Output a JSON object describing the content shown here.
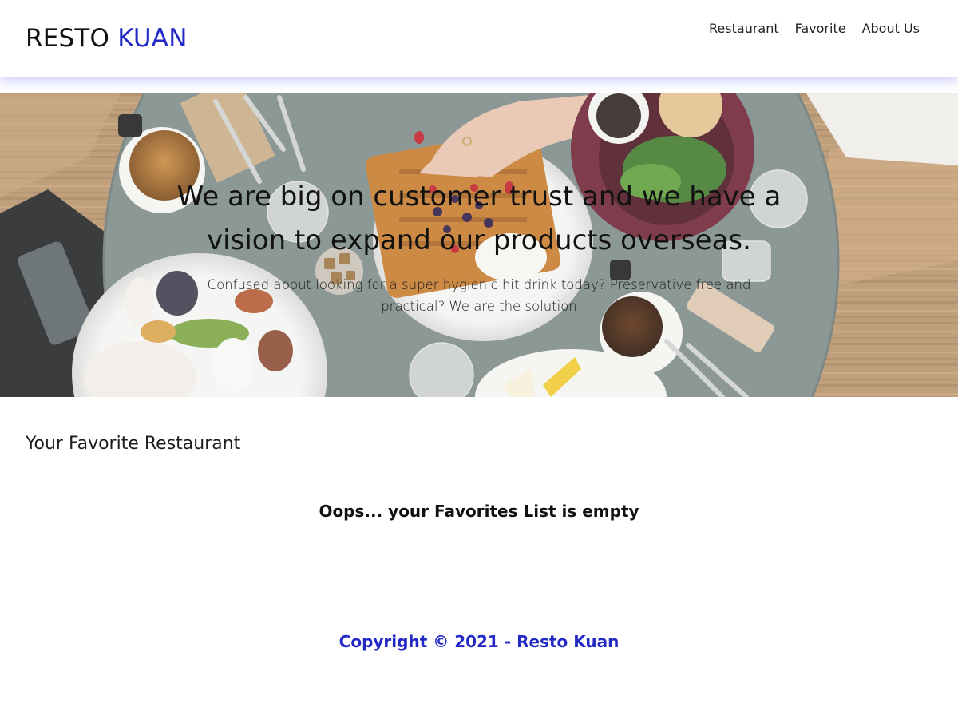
{
  "header": {
    "brand": {
      "part1": "RESTO",
      "part2": "KUAN"
    },
    "nav": [
      {
        "label": "Restaurant"
      },
      {
        "label": "Favorite"
      },
      {
        "label": "About Us"
      }
    ]
  },
  "hero": {
    "title": "We are big on customer trust and we have a vision to expand our products overseas.",
    "subtitle": "Confused about looking for a super hygienic hit drink today? Preservative free and practical? We are the solution"
  },
  "main": {
    "section_title": "Your Favorite Restaurant",
    "empty_message": "Oops... your Favorites List is empty"
  },
  "footer": {
    "copyright": "Copyright © 2021 - Resto Kuan"
  },
  "colors": {
    "accent": "#2229c4",
    "header_shadow": "#3c46e6"
  }
}
